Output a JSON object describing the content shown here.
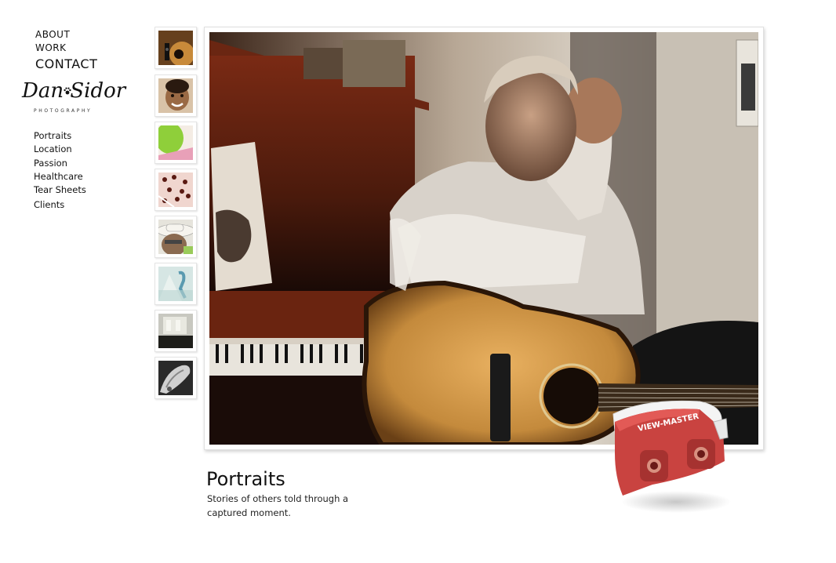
{
  "topnav": {
    "about": "ABOUT",
    "work": "WORK",
    "contact": "CONTACT"
  },
  "logo": {
    "name": "Dan Sidor",
    "subtitle": "PHOTOGRAPHY"
  },
  "categories": [
    "Portraits",
    "Location",
    "Passion",
    "Healthcare",
    "Tear Sheets",
    "Clients"
  ],
  "thumbnails": [
    {
      "name": "guitar-thumbnail"
    },
    {
      "name": "child-portrait-thumbnail"
    },
    {
      "name": "green-balloon-thumbnail"
    },
    {
      "name": "pills-thumbnail"
    },
    {
      "name": "cowboy-hat-thumbnail"
    },
    {
      "name": "ribbon-thumbnail"
    },
    {
      "name": "interior-thumbnail"
    },
    {
      "name": "xray-thumbnail"
    }
  ],
  "caption": {
    "title": "Portraits",
    "text": "Stories of others told through a captured moment."
  },
  "viewmaster": {
    "label": "VIEW-MASTER",
    "color": "#c94340"
  }
}
